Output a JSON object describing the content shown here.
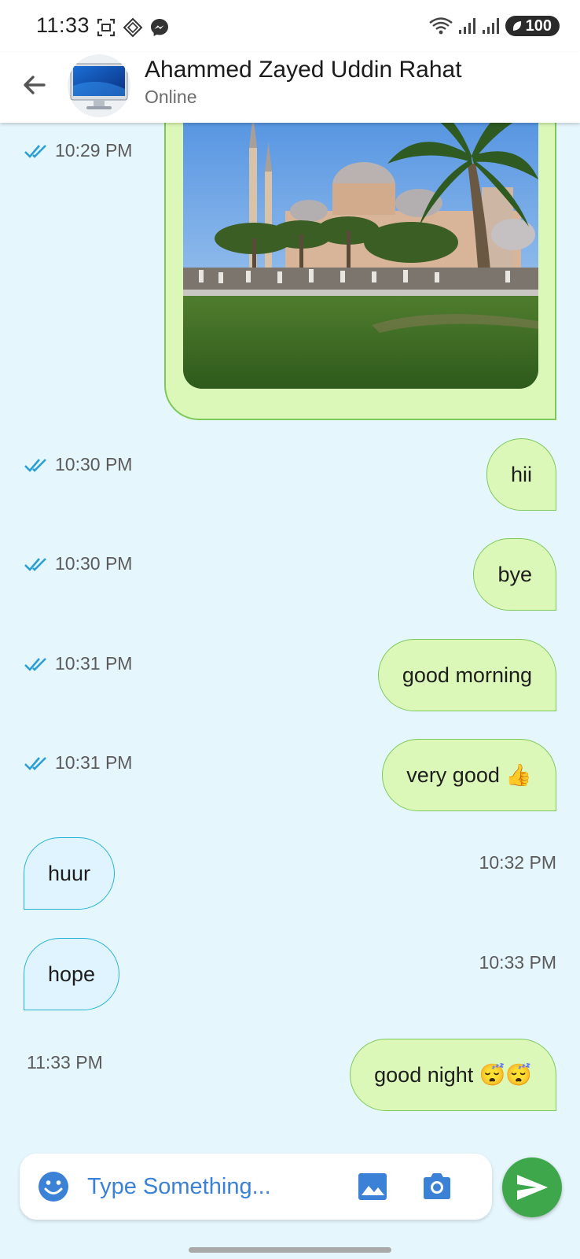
{
  "status_bar": {
    "time": "11:33",
    "battery": "100"
  },
  "header": {
    "contact_name": "Ahammed Zayed Uddin Rahat",
    "presence": "Online"
  },
  "messages": [
    {
      "type": "image",
      "direction": "out",
      "time": "10:29 PM",
      "read": true
    },
    {
      "type": "text",
      "direction": "out",
      "text": "hii",
      "time": "10:30 PM",
      "read": true
    },
    {
      "type": "text",
      "direction": "out",
      "text": "bye",
      "time": "10:30 PM",
      "read": true
    },
    {
      "type": "text",
      "direction": "out",
      "text": "good morning",
      "time": "10:31 PM",
      "read": true
    },
    {
      "type": "text",
      "direction": "out",
      "text": "very good 👍",
      "time": "10:31 PM",
      "read": true
    },
    {
      "type": "text",
      "direction": "in",
      "text": "huur",
      "time": "10:32 PM"
    },
    {
      "type": "text",
      "direction": "in",
      "text": "hope",
      "time": "10:33 PM"
    },
    {
      "type": "text",
      "direction": "out",
      "text": "good night 😴😴",
      "time": "11:33 PM",
      "read": false
    }
  ],
  "composer": {
    "placeholder": "Type Something..."
  },
  "icons": {
    "back": "back-arrow-icon",
    "emoji": "emoji-icon",
    "gallery": "image-icon",
    "camera": "camera-icon",
    "send": "send-icon",
    "read_receipt": "double-check-icon"
  },
  "colors": {
    "chat_background": "#e6f6fd",
    "outgoing_bubble": "#dcf8b8",
    "outgoing_border": "#7cc95a",
    "incoming_bubble": "#dff4fe",
    "incoming_border": "#25b3d6",
    "accent_blue": "#3b82d6",
    "send_button": "#3fa74b",
    "read_tick": "#2a9fd6"
  }
}
